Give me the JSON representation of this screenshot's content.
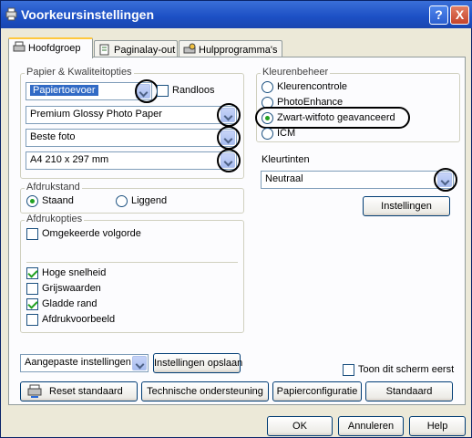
{
  "window": {
    "title": "Voorkeursinstellingen",
    "help_label": "?",
    "close_label": "X"
  },
  "tabs": [
    {
      "label": "Hoofdgroep",
      "icon": "printer-settings-icon",
      "active": true
    },
    {
      "label": "Paginalay-out",
      "icon": "page-layout-icon",
      "active": false
    },
    {
      "label": "Hulpprogramma's",
      "icon": "utility-icon",
      "active": false
    }
  ],
  "paper_quality": {
    "legend": "Papier & Kwaliteitopties",
    "source": "Papiertoevoer",
    "borderless_label": "Randloos",
    "borderless_checked": false,
    "media_type": "Premium Glossy Photo Paper",
    "quality": "Beste foto",
    "paper_size": "A4 210 x 297 mm"
  },
  "orientation": {
    "legend": "Afdrukstand",
    "portrait_label": "Staand",
    "landscape_label": "Liggend",
    "selected": "portrait"
  },
  "print_options": {
    "legend": "Afdrukopties",
    "reverse_order": {
      "label": "Omgekeerde volgorde",
      "checked": false
    },
    "high_speed": {
      "label": "Hoge snelheid",
      "checked": true
    },
    "grayscale": {
      "label": "Grijswaarden",
      "checked": false
    },
    "smooth_edge": {
      "label": "Gladde rand",
      "checked": true
    },
    "print_preview": {
      "label": "Afdrukvoorbeeld",
      "checked": false
    }
  },
  "color_management": {
    "legend": "Kleurenbeheer",
    "options": [
      "Kleurencontrole",
      "PhotoEnhance",
      "Zwart-witfoto geavanceerd",
      "ICM"
    ],
    "selected_index": 2,
    "tone_label": "Kleurtinten",
    "tone_value": "Neutraal",
    "settings_button": "Instellingen"
  },
  "presets": {
    "selected": "Aangepaste instellingen",
    "save_button": "Instellingen opslaan"
  },
  "show_screen_first": {
    "label": "Toon dit scherm eerst",
    "checked": false
  },
  "bottom_buttons": {
    "reset": "Reset standaard",
    "tech_support": "Technische ondersteuning",
    "paper_config": "Papierconfiguratie",
    "standard": "Standaard"
  },
  "dialog_buttons": {
    "ok": "OK",
    "cancel": "Annuleren",
    "help": "Help"
  }
}
